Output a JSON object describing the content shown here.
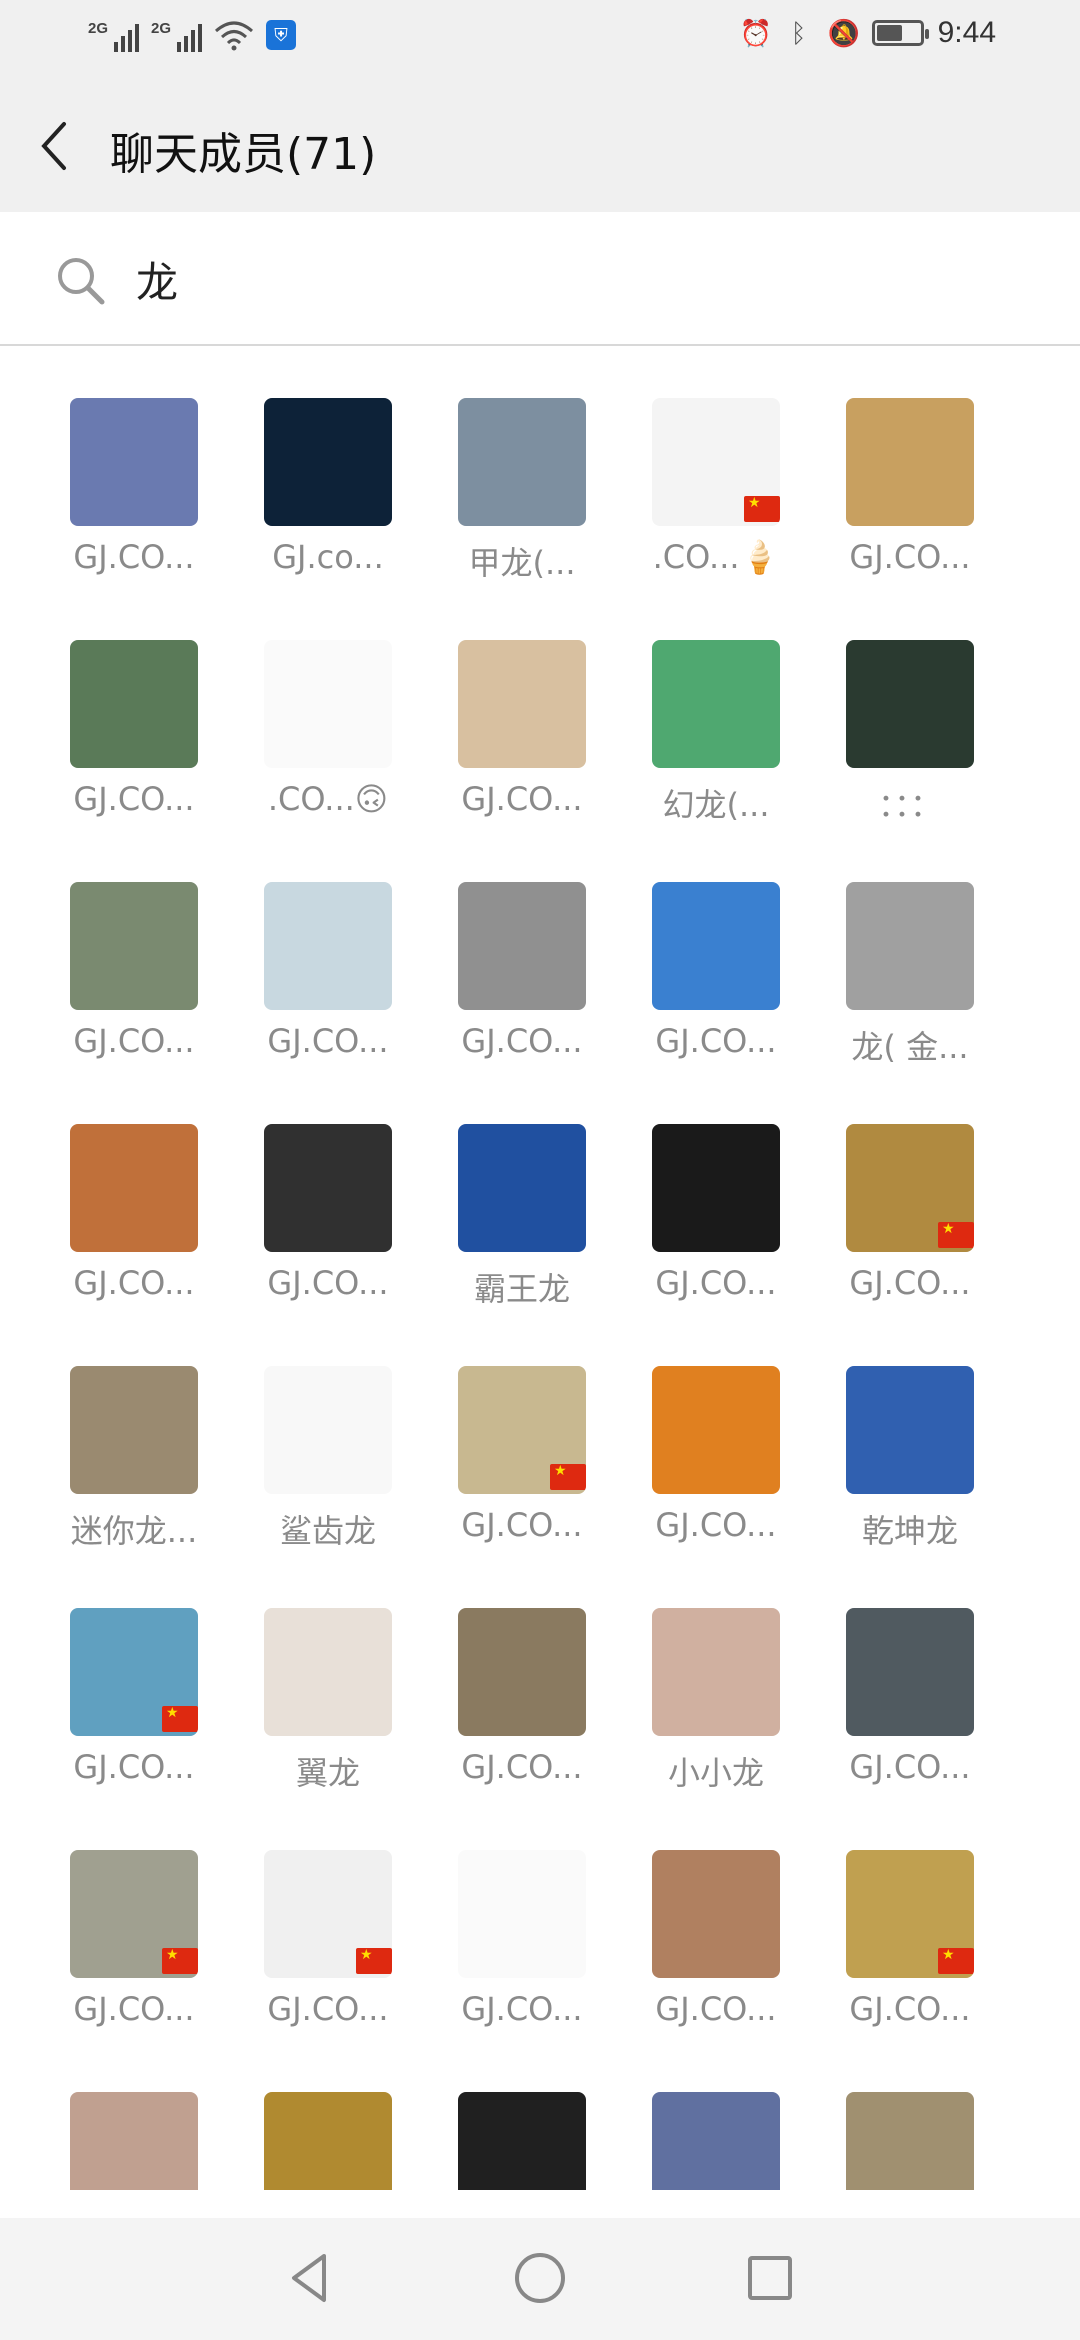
{
  "status_bar": {
    "network1": "2G",
    "network2": "2G",
    "time": "9:44",
    "battery_level": 0.6,
    "icons": [
      "signal-icon",
      "signal-icon",
      "wifi-icon",
      "shield-icon",
      "alarm-icon",
      "bluetooth-icon",
      "mute-icon",
      "battery-icon"
    ]
  },
  "header": {
    "title": "聊天成员(71)",
    "back_icon": "chevron-left-icon"
  },
  "search": {
    "value": "龙",
    "icon": "search-icon"
  },
  "members": [
    {
      "name": "GJ.CO...",
      "color": "#6a7ab0",
      "flag": false
    },
    {
      "name": "GJ.co...",
      "color": "#0d2238",
      "flag": false
    },
    {
      "name": "甲龙(...",
      "color": "#7d8fa0",
      "flag": false
    },
    {
      "name": ".CO...🍦",
      "color": "#f4f4f4",
      "flag": true
    },
    {
      "name": "GJ.CO...",
      "color": "#c8a060",
      "flag": false
    },
    {
      "name": "GJ.CO...",
      "color": "#5a7a58",
      "flag": false
    },
    {
      "name": ".CO...🙃",
      "color": "#fafafa",
      "flag": false
    },
    {
      "name": "GJ.CO...",
      "color": "#d8c0a0",
      "flag": false
    },
    {
      "name": "幻龙(...",
      "color": "#4fa870",
      "flag": false
    },
    {
      "name": "：：：",
      "color": "#2a3a30",
      "flag": false
    },
    {
      "name": "GJ.CO...",
      "color": "#7a8a70",
      "flag": false
    },
    {
      "name": "GJ.CO...",
      "color": "#c8d8e0",
      "flag": false
    },
    {
      "name": "GJ.CO...",
      "color": "#909090",
      "flag": false
    },
    {
      "name": "GJ.CO...",
      "color": "#3a80d0",
      "flag": false
    },
    {
      "name": "龙( 金...",
      "color": "#a0a0a0",
      "flag": false
    },
    {
      "name": "GJ.CO...",
      "color": "#c0703a",
      "flag": false
    },
    {
      "name": "GJ.CO...",
      "color": "#303030",
      "flag": false
    },
    {
      "name": "霸王龙",
      "color": "#2050a0",
      "flag": false
    },
    {
      "name": "GJ.CO...",
      "color": "#1a1a1a",
      "flag": false
    },
    {
      "name": "GJ.CO...",
      "color": "#b08a40",
      "flag": true
    },
    {
      "name": "迷你龙...",
      "color": "#9a8a70",
      "flag": false
    },
    {
      "name": "鲨齿龙",
      "color": "#f8f8f8",
      "flag": false
    },
    {
      "name": "GJ.CO...",
      "color": "#c8b890",
      "flag": true
    },
    {
      "name": "GJ.CO...",
      "color": "#e08020",
      "flag": false
    },
    {
      "name": "乾坤龙",
      "color": "#3060b0",
      "flag": false
    },
    {
      "name": "GJ.CO...",
      "color": "#60a0c0",
      "flag": true
    },
    {
      "name": "翼龙",
      "color": "#e8e0d8",
      "flag": false
    },
    {
      "name": "GJ.CO...",
      "color": "#8a7a60",
      "flag": false
    },
    {
      "name": "小小龙",
      "color": "#d0b0a0",
      "flag": false
    },
    {
      "name": "GJ.CO...",
      "color": "#505a60",
      "flag": false
    },
    {
      "name": "GJ.CO...",
      "color": "#a0a090",
      "flag": true
    },
    {
      "name": "GJ.CO...",
      "color": "#f0f0f0",
      "flag": true
    },
    {
      "name": "GJ.CO...",
      "color": "#fafafa",
      "flag": false
    },
    {
      "name": "GJ.CO...",
      "color": "#b08060",
      "flag": false
    },
    {
      "name": "GJ.CO...",
      "color": "#c0a050",
      "flag": true
    },
    {
      "name": "",
      "color": "#c0a090",
      "flag": false
    },
    {
      "name": "",
      "color": "#b08a30",
      "flag": false
    },
    {
      "name": "",
      "color": "#202020",
      "flag": false
    },
    {
      "name": "",
      "color": "#6070a0",
      "flag": false
    },
    {
      "name": "",
      "color": "#a09070",
      "flag": false
    }
  ],
  "nav_bar": {
    "icons": [
      "back-triangle-icon",
      "home-circle-icon",
      "recents-square-icon"
    ]
  }
}
